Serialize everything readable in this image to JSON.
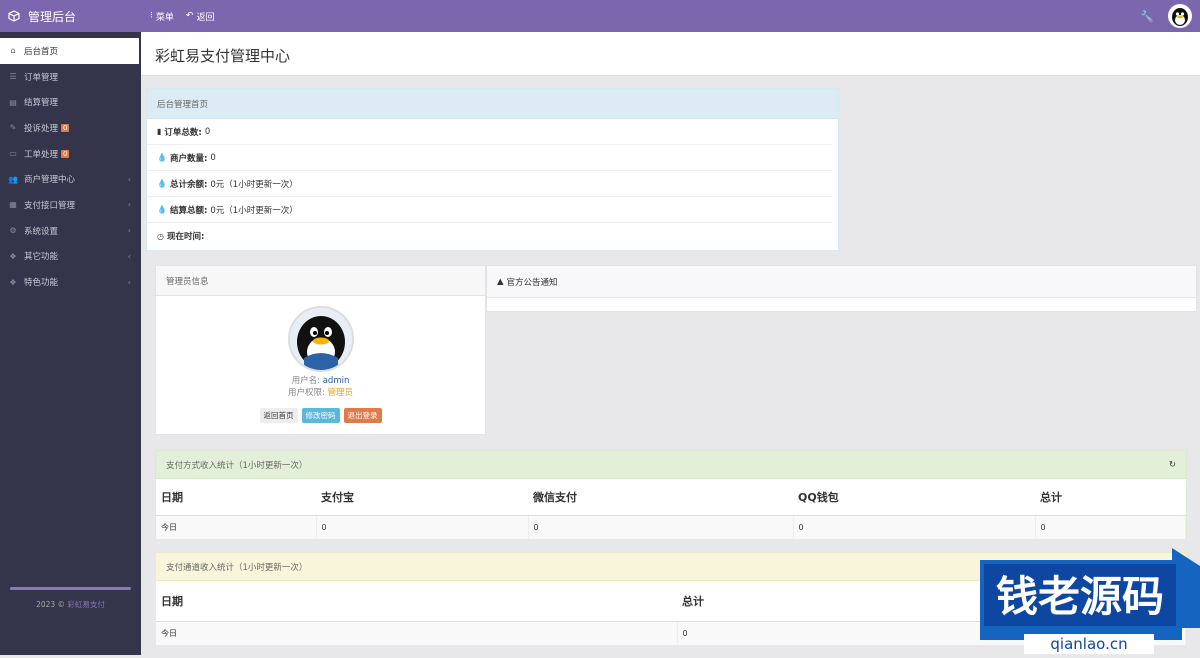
{
  "app": {
    "title": "管理后台"
  },
  "topnav": {
    "menu": "菜单",
    "back": "返回"
  },
  "sidebar": {
    "items": [
      {
        "label": "后台首页",
        "icon": "home-icon"
      },
      {
        "label": "订单管理",
        "icon": "list-icon"
      },
      {
        "label": "结算管理",
        "icon": "file-icon"
      },
      {
        "label": "投诉处理",
        "icon": "edit-icon",
        "badge": "0"
      },
      {
        "label": "工单处理",
        "icon": "ticket-icon",
        "badge": "0"
      },
      {
        "label": "商户管理中心",
        "icon": "users-icon"
      },
      {
        "label": "支付接口管理",
        "icon": "grid-icon"
      },
      {
        "label": "系统设置",
        "icon": "gear-icon"
      },
      {
        "label": "其它功能",
        "icon": "cubes-icon"
      },
      {
        "label": "特色功能",
        "icon": "cubes-icon"
      }
    ],
    "footer_prefix": "2023 © ",
    "footer_link": "彩虹易支付"
  },
  "page": {
    "title": "彩虹易支付管理中心"
  },
  "overview": {
    "header": "后台管理首页",
    "rows": [
      {
        "label": "订单总数:",
        "value": "0",
        "icon": "bar-chart-icon"
      },
      {
        "label": "商户数量:",
        "value": "0",
        "icon": "drop-icon"
      },
      {
        "label": "总计余额:",
        "value": "0元（1小时更新一次）",
        "icon": "drop-icon"
      },
      {
        "label": "结算总额:",
        "value": "0元（1小时更新一次）",
        "icon": "drop-icon"
      },
      {
        "label": "现在时间:",
        "value": "",
        "icon": "clock-icon"
      }
    ]
  },
  "admin": {
    "header": "管理员信息",
    "username_label": "用户名:",
    "username": "admin",
    "role_label": "用户权限:",
    "role": "管理员",
    "btn_home": "返回首页",
    "btn_password": "修改密码",
    "btn_logout": "退出登录"
  },
  "notice": {
    "header": "官方公告通知"
  },
  "pay_stats": {
    "header": "支付方式收入统计（1小时更新一次）",
    "columns": [
      "日期",
      "支付宝",
      "微信支付",
      "QQ钱包",
      "总计"
    ],
    "row": [
      "今日",
      "0",
      "0",
      "0",
      "0"
    ]
  },
  "channel_stats": {
    "header": "支付通道收入统计（1小时更新一次）",
    "columns": [
      "日期",
      "总计"
    ],
    "row": [
      "今日",
      "0"
    ]
  },
  "watermark": {
    "text": "钱老源码",
    "url": "qianlao.cn"
  },
  "colors": {
    "topbar": "#7c66ae",
    "sidebar": "#34344a",
    "accent": "#8d78bd"
  }
}
